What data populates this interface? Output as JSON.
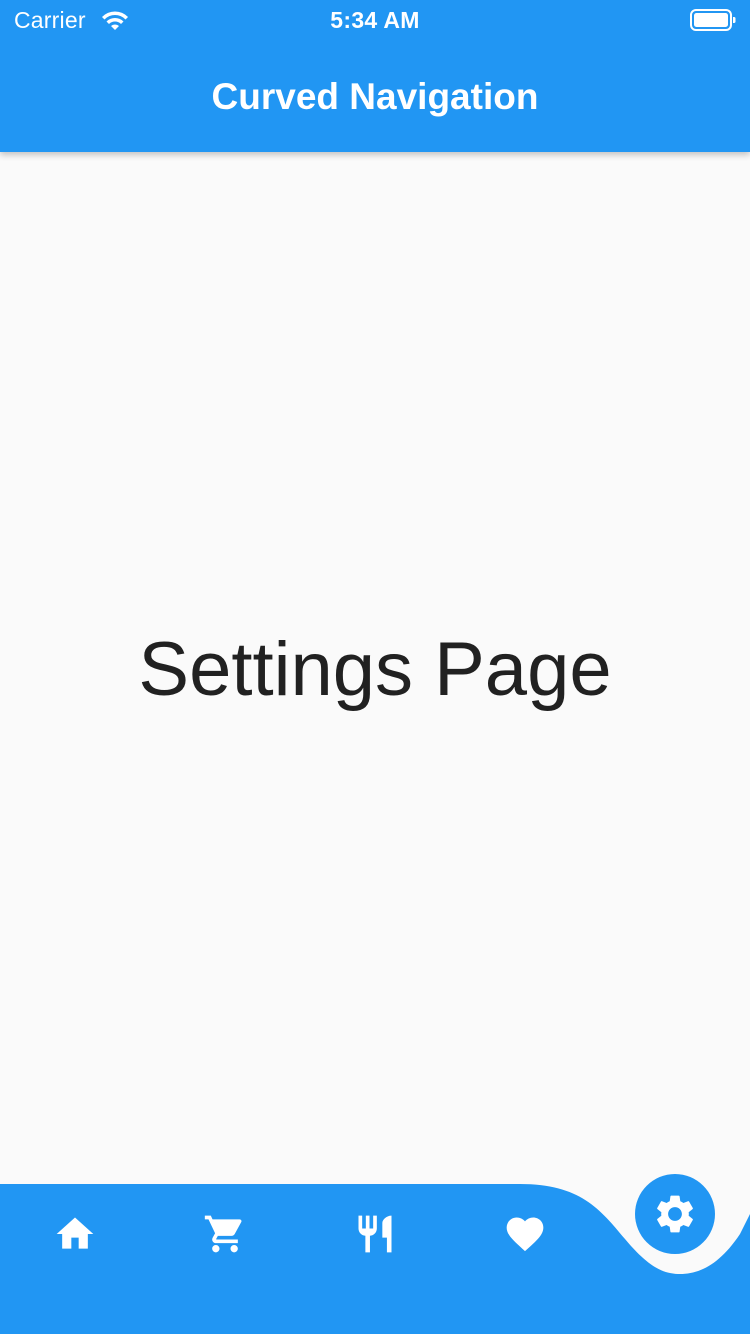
{
  "status_bar": {
    "carrier": "Carrier",
    "time": "5:34 AM"
  },
  "app_bar": {
    "title": "Curved Navigation"
  },
  "main": {
    "page_label": "Settings Page"
  },
  "bottom_nav": {
    "items": [
      {
        "icon": "home-icon"
      },
      {
        "icon": "shopping-cart-icon"
      },
      {
        "icon": "restaurant-icon"
      },
      {
        "icon": "heart-icon"
      },
      {
        "icon": "gear-icon",
        "selected": true
      }
    ]
  },
  "colors": {
    "primary": "#2196f3",
    "background": "#fafafa",
    "text": "#212121",
    "on_primary": "#ffffff"
  }
}
